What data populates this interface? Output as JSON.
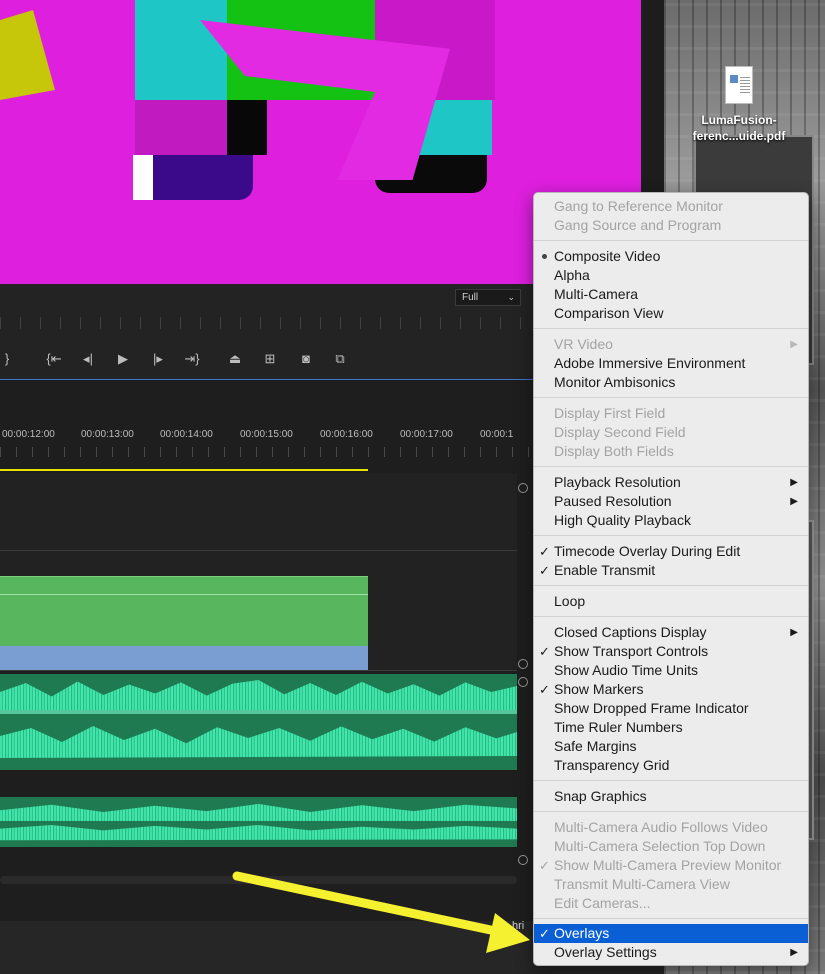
{
  "desktop": {
    "file_name_line1": "LumaFusion-",
    "file_name_line2": "ferenc...uide.pdf"
  },
  "monitor": {
    "resolution": "Full"
  },
  "timeline": {
    "timecodes": [
      "00:00:12:00",
      "00:00:13:00",
      "00:00:14:00",
      "00:00:15:00",
      "00:00:16:00",
      "00:00:17:00",
      "00:00:1"
    ]
  },
  "status": {
    "partial_text": "hri"
  },
  "menu": {
    "items": [
      {
        "label": "Gang to Reference Monitor",
        "state": "disabled"
      },
      {
        "label": "Gang Source and Program",
        "state": "disabled"
      },
      {
        "label": "Composite Video",
        "state": "radio"
      },
      {
        "label": "Alpha",
        "state": "normal"
      },
      {
        "label": "Multi-Camera",
        "state": "normal"
      },
      {
        "label": "Comparison View",
        "state": "normal"
      },
      {
        "label": "VR Video",
        "state": "disabled-submenu"
      },
      {
        "label": "Adobe Immersive Environment",
        "state": "normal"
      },
      {
        "label": "Monitor Ambisonics",
        "state": "normal"
      },
      {
        "label": "Display First Field",
        "state": "disabled"
      },
      {
        "label": "Display Second Field",
        "state": "disabled"
      },
      {
        "label": "Display Both Fields",
        "state": "disabled"
      },
      {
        "label": "Playback Resolution",
        "state": "submenu"
      },
      {
        "label": "Paused Resolution",
        "state": "submenu"
      },
      {
        "label": "High Quality Playback",
        "state": "normal"
      },
      {
        "label": "Timecode Overlay During Edit",
        "state": "checked"
      },
      {
        "label": "Enable Transmit",
        "state": "checked"
      },
      {
        "label": "Loop",
        "state": "normal"
      },
      {
        "label": "Closed Captions Display",
        "state": "submenu"
      },
      {
        "label": "Show Transport Controls",
        "state": "checked"
      },
      {
        "label": "Show Audio Time Units",
        "state": "normal"
      },
      {
        "label": "Show Markers",
        "state": "checked"
      },
      {
        "label": "Show Dropped Frame Indicator",
        "state": "normal"
      },
      {
        "label": "Time Ruler Numbers",
        "state": "normal"
      },
      {
        "label": "Safe Margins",
        "state": "normal"
      },
      {
        "label": "Transparency Grid",
        "state": "normal"
      },
      {
        "label": "Snap Graphics",
        "state": "normal"
      },
      {
        "label": "Multi-Camera Audio Follows Video",
        "state": "disabled"
      },
      {
        "label": "Multi-Camera Selection Top Down",
        "state": "disabled"
      },
      {
        "label": "Show Multi-Camera Preview Monitor",
        "state": "disabled-checked"
      },
      {
        "label": "Transmit Multi-Camera View",
        "state": "disabled"
      },
      {
        "label": "Edit Cameras...",
        "state": "disabled"
      },
      {
        "label": "Overlays",
        "state": "checked-highlighted"
      },
      {
        "label": "Overlay Settings",
        "state": "submenu"
      }
    ]
  },
  "colors": {
    "menu_highlight": "#0a5fd5",
    "annotation_arrow": "#f5f030",
    "video_magenta": "#de1fde"
  }
}
